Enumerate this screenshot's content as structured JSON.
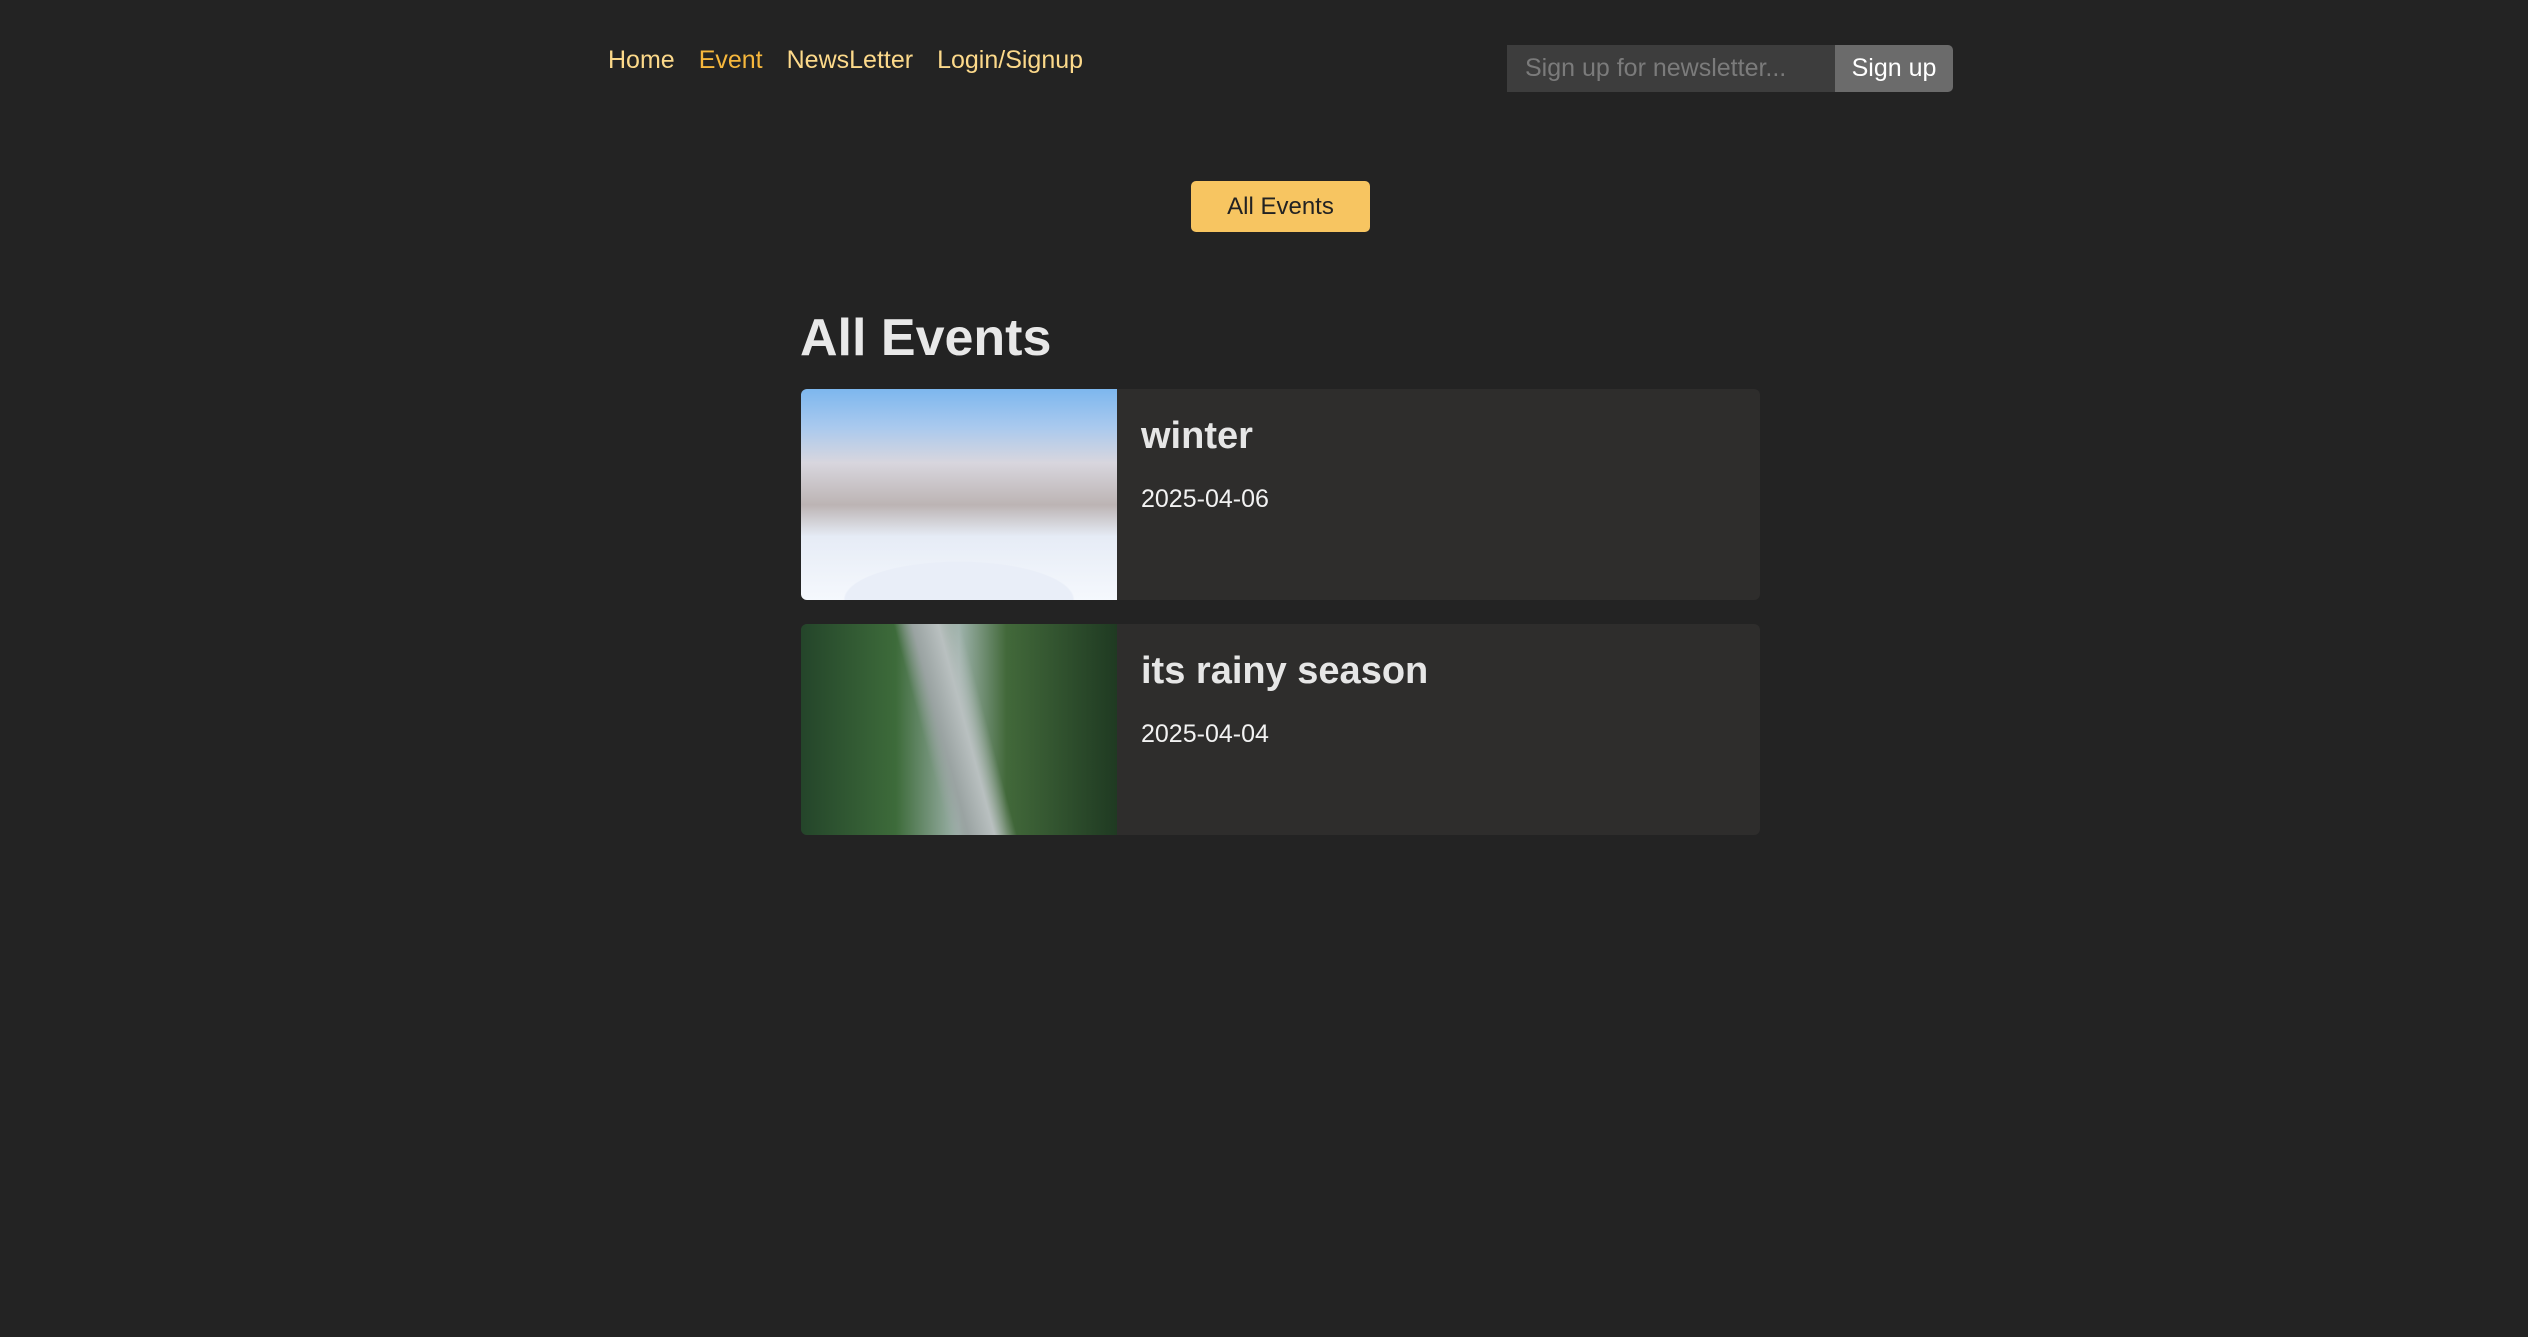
{
  "nav": {
    "items": [
      {
        "label": "Home"
      },
      {
        "label": "Event",
        "active": true
      },
      {
        "label": "NewsLetter"
      },
      {
        "label": "Login/Signup"
      }
    ]
  },
  "newsletter": {
    "placeholder": "Sign up for newsletter...",
    "value": "",
    "button": "Sign up"
  },
  "filter_button": "All Events",
  "heading": "All Events",
  "events": [
    {
      "title": "winter",
      "date": "2025-04-06",
      "image": "snowy-trees-image"
    },
    {
      "title": "its rainy season",
      "date": "2025-04-04",
      "image": "rainy-forest-road-image"
    }
  ],
  "colors": {
    "background": "#232323",
    "card": "#2e2d2c",
    "accent": "#f7c561",
    "nav_link": "#fcd98a",
    "nav_active": "#f6b73c"
  }
}
